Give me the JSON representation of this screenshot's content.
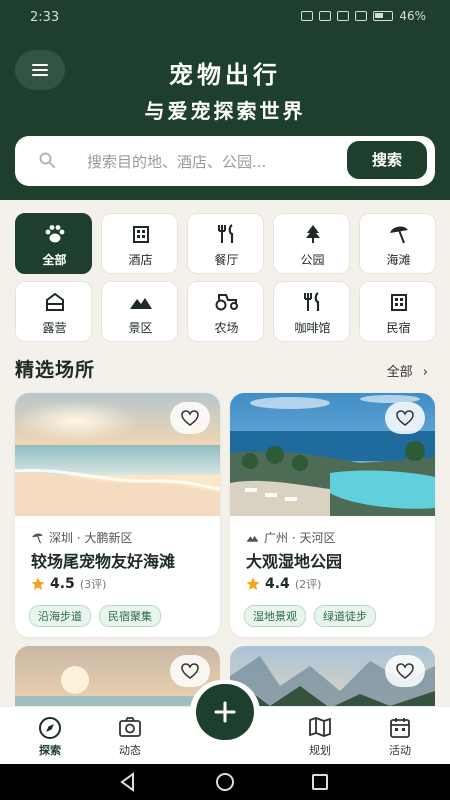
{
  "status_bar": {
    "time": "2:33",
    "battery": "46%"
  },
  "header": {
    "title": "宠物出行",
    "subtitle": "与爱宠探索世界",
    "bg_color": "#1e3f2e"
  },
  "search": {
    "placeholder": "搜索目的地、酒店、公园...",
    "button_label": "搜索"
  },
  "categories": [
    {
      "label": "全部",
      "icon": "paw-icon",
      "active": true
    },
    {
      "label": "酒店",
      "icon": "hotel-icon"
    },
    {
      "label": "餐厅",
      "icon": "restaurant-icon"
    },
    {
      "label": "公园",
      "icon": "tree-icon"
    },
    {
      "label": "海滩",
      "icon": "umbrella-icon"
    },
    {
      "label": "露营",
      "icon": "tent-icon"
    },
    {
      "label": "景区",
      "icon": "mountain-icon"
    },
    {
      "label": "农场",
      "icon": "tractor-icon"
    },
    {
      "label": "咖啡馆",
      "icon": "cafe-icon"
    },
    {
      "label": "民宿",
      "icon": "guesthouse-icon"
    }
  ],
  "featured": {
    "title": "精选场所",
    "see_all": "全部",
    "cards": [
      {
        "location": "深圳 · 大鹏新区",
        "name": "较场尾宠物友好海滩",
        "rating": "4.5",
        "reviews": "(3评)",
        "tags": [
          "沿海步道",
          "民宿聚集"
        ]
      },
      {
        "location": "广州 · 天河区",
        "name": "大观湿地公园",
        "rating": "4.4",
        "reviews": "(2评)",
        "tags": [
          "湿地景观",
          "绿道徒步"
        ]
      }
    ]
  },
  "bottom_nav": {
    "items": [
      {
        "label": "探索",
        "icon": "compass-icon",
        "active": true
      },
      {
        "label": "动态",
        "icon": "camera-icon"
      },
      {
        "label": "规划",
        "icon": "map-icon"
      },
      {
        "label": "活动",
        "icon": "calendar-icon"
      }
    ]
  },
  "colors": {
    "primary": "#1e3f2e",
    "accent_star": "#f2a516",
    "tag_green": "#2b6a4b"
  }
}
